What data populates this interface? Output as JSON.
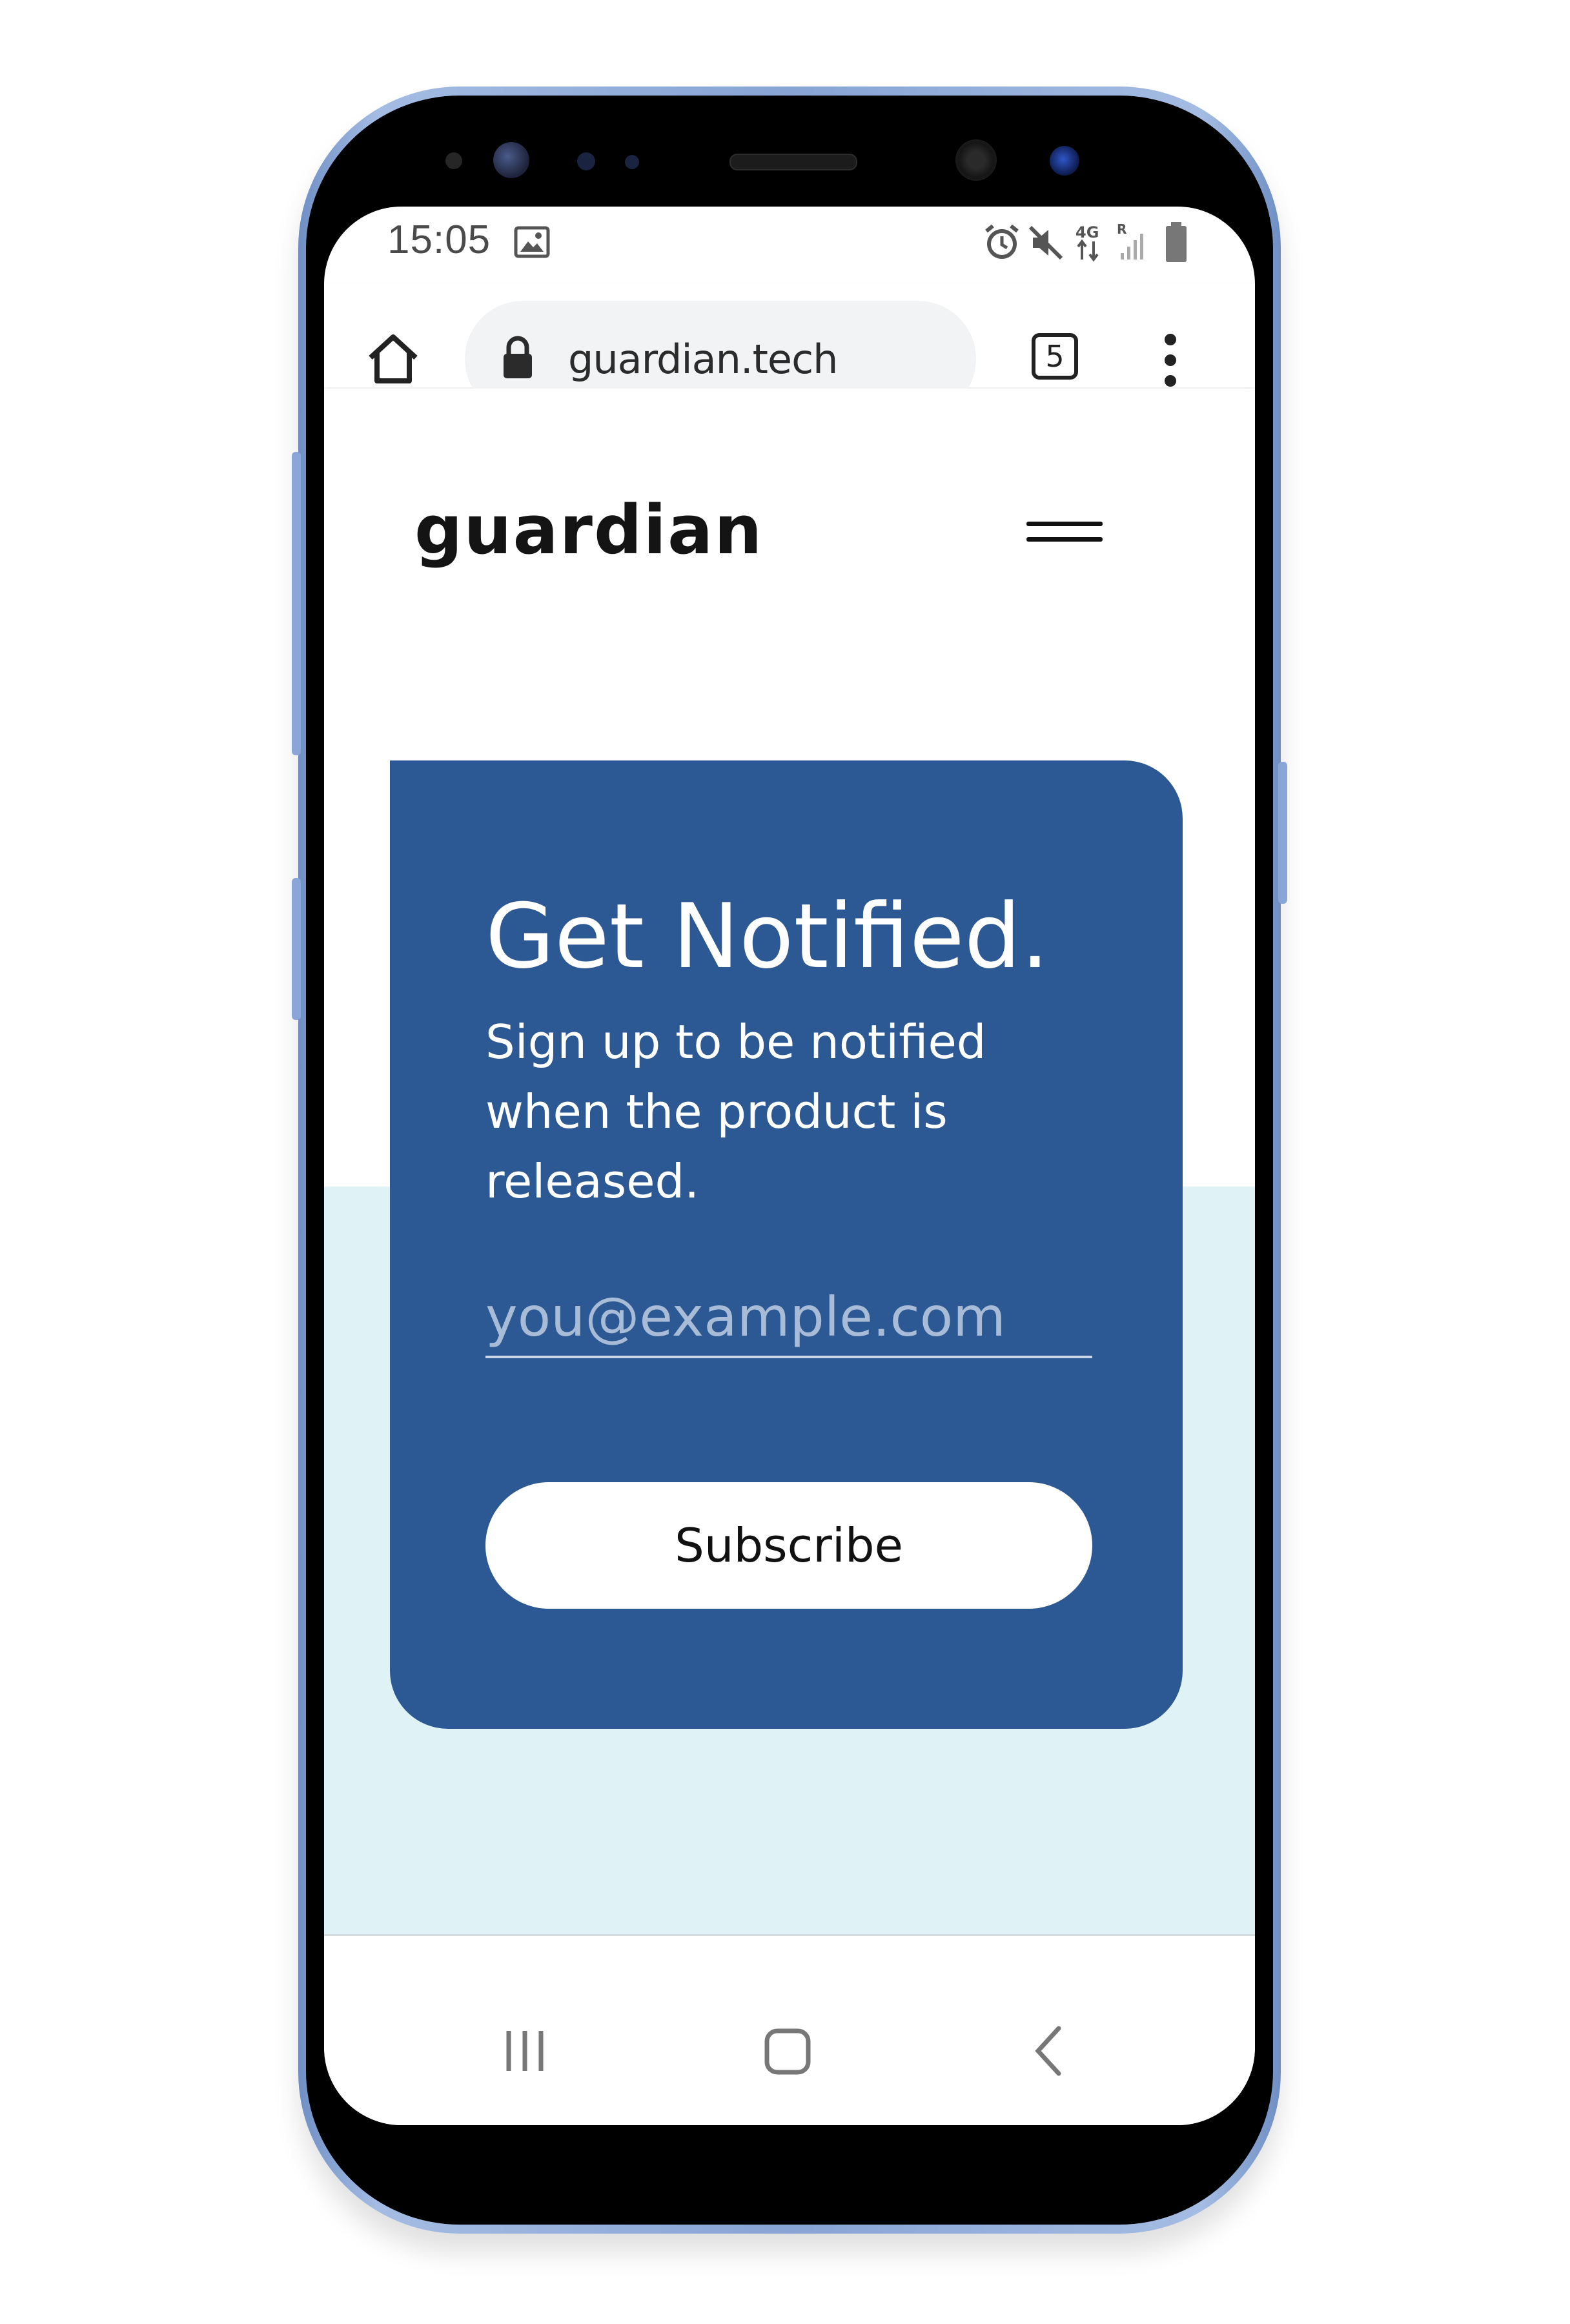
{
  "status_bar": {
    "time": "15:05",
    "icons": [
      "gallery-icon",
      "alarm-icon",
      "mute-icon",
      "network-4g-icon",
      "signal-icon",
      "battery-icon"
    ]
  },
  "browser": {
    "url": "guardian.tech",
    "tab_count": "5",
    "icons": [
      "home-icon",
      "lock-icon",
      "tab-switcher-icon",
      "more-vert-icon"
    ]
  },
  "header": {
    "logo": "guardian",
    "menu_icon": "hamburger-menu-icon"
  },
  "signup_card": {
    "title": "Get Notified.",
    "subtitle": "Sign up to be notified when the product is released.",
    "email_placeholder": "you@example.com",
    "button_label": "Subscribe"
  },
  "nav_bar": {
    "icons": [
      "recents-icon",
      "home-nav-icon",
      "back-icon"
    ]
  },
  "colors": {
    "card_background": "#2c5993",
    "page_tint": "#dff2f5",
    "phone_frame": "#87a4d4"
  }
}
